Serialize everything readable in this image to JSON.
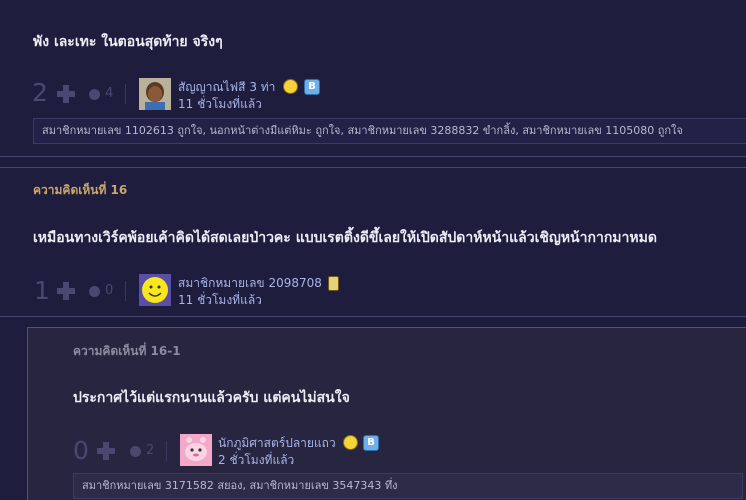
{
  "comment_top": {
    "text": "พัง เละเทะ ในตอนสุดท้าย จริงๆ",
    "votes": "2",
    "emotions": "4",
    "user": "สัญญาณไฟสี 3 ท่า",
    "time": "11 ชั่วโมงที่แล้ว",
    "badge_b": "B",
    "reactions": "สมาชิกหมายเลข 1102613 ถูกใจ, นอกหน้าต่างมีแต่หิมะ ถูกใจ, สมาชิกหมายเลข 3288832 ขำกลิ้ง, สมาชิกหมายเลข 1105080 ถูกใจ"
  },
  "comment_16": {
    "title": "ความคิดเห็นที่ 16",
    "text": "เหมือนทางเวิร์คพ้อยเค้าคิดได้สดเลยป่าวคะ แบบเรตติ้งดีขึ้เลยให้เปิดสัปดาห์หน้าแล้วเชิญหน้ากากมาหมด",
    "votes": "1",
    "emotions": "0",
    "user": "สมาชิกหมายเลข 2098708",
    "time": "11 ชั่วโมงที่แล้ว"
  },
  "reply_16_1": {
    "title": "ความคิดเห็นที่ 16-1",
    "text": "ประกาศไว้แต่แรกนานแล้วครับ แต่คนไม่สนใจ",
    "votes": "0",
    "emotions": "2",
    "user": "นักภูมิศาสตร์ปลายแถว",
    "time": "2 ชั่วโมงที่แล้ว",
    "badge_b": "B",
    "reactions": "สมาชิกหมายเลข 3171582 สยอง, สมาชิกหมายเลข 3547343 ทึ่ง"
  },
  "colors": {
    "background": "#1f1d3d",
    "reply_background": "#27253f",
    "comment_title": "#c9a66b",
    "username": "#a7b4e8"
  }
}
